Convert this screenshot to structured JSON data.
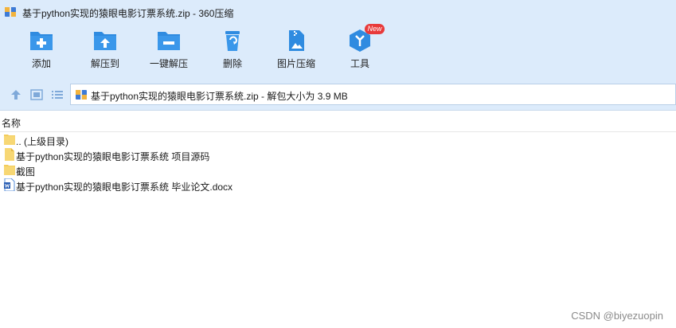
{
  "window": {
    "title": "基于python实现的猿眼电影订票系统.zip - 360压缩"
  },
  "toolbar": {
    "buttons": [
      {
        "label": "添加",
        "icon": "add-icon"
      },
      {
        "label": "解压到",
        "icon": "extract-to-icon"
      },
      {
        "label": "一键解压",
        "icon": "one-click-extract-icon"
      },
      {
        "label": "删除",
        "icon": "delete-icon"
      },
      {
        "label": "图片压缩",
        "icon": "image-compress-icon"
      },
      {
        "label": "工具",
        "icon": "tools-icon",
        "badge": "New"
      }
    ]
  },
  "navbar": {
    "path_text": "基于python实现的猿眼电影订票系统.zip - 解包大小为 3.9 MB"
  },
  "list": {
    "column_name": "名称",
    "items": [
      {
        "name": ".. (上级目录)",
        "type": "folder"
      },
      {
        "name": "基于python实现的猿眼电影订票系统 项目源码",
        "type": "file"
      },
      {
        "name": "截图",
        "type": "folder"
      },
      {
        "name": "基于python实现的猿眼电影订票系统 毕业论文.docx",
        "type": "docx"
      }
    ]
  },
  "watermark": "CSDN @biyezuopin",
  "colors": {
    "chrome_bg": "#dcebfb",
    "icon_blue": "#2f8be0",
    "badge_red": "#e83a3a",
    "folder_yellow": "#f7d774"
  }
}
